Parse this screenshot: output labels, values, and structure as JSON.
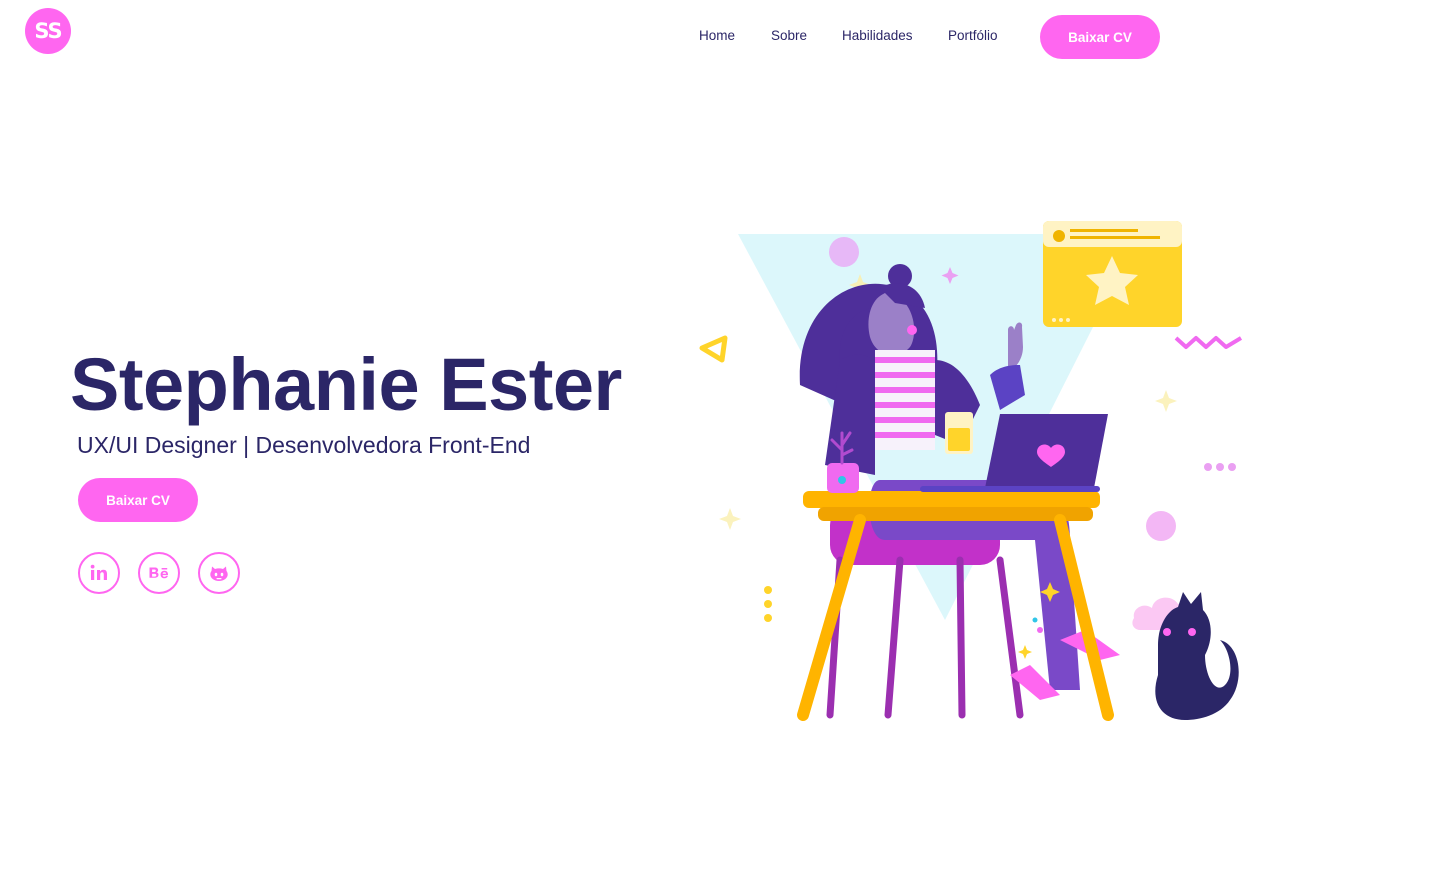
{
  "logo": {
    "text": "SS"
  },
  "nav": {
    "links": [
      {
        "label": "Home"
      },
      {
        "label": "Sobre"
      },
      {
        "label": "Habilidades"
      },
      {
        "label": "Portfólio"
      }
    ],
    "cta_label": "Baixar CV"
  },
  "hero": {
    "name": "Stephanie Ester",
    "subtitle": "UX/UI Designer | Desenvolvedora Front-End",
    "cta_label": "Baixar CV"
  },
  "social": [
    {
      "icon": "linkedin-icon"
    },
    {
      "icon": "behance-icon"
    },
    {
      "icon": "github-icon"
    }
  ],
  "colors": {
    "accent": "#ff66f0",
    "text": "#2b2667",
    "illustration_bg": "#dcf7fb",
    "yellow": "#ffd42a",
    "purple": "#4e2f9a"
  }
}
